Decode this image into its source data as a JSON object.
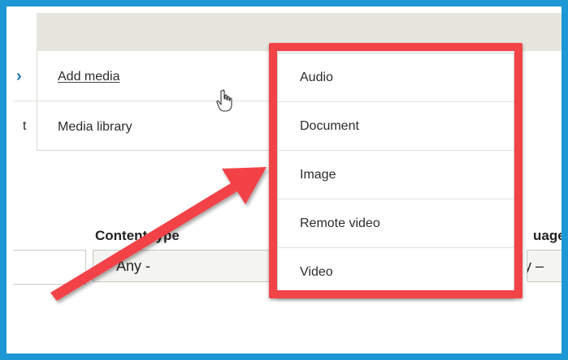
{
  "submenu": {
    "items": [
      {
        "label": "Add media",
        "icon": "chevron-right-icon"
      },
      {
        "label": "Media library"
      }
    ],
    "left_fragment": "t"
  },
  "dropdown": {
    "items": [
      {
        "label": "Audio"
      },
      {
        "label": "Document"
      },
      {
        "label": "Image"
      },
      {
        "label": "Remote video"
      },
      {
        "label": "Video"
      }
    ]
  },
  "filters": {
    "content_type": {
      "label": "Content type",
      "value": "- Any -"
    },
    "language": {
      "label": "uage",
      "value": "ny –"
    }
  },
  "colors": {
    "frame": "#1d97d6",
    "highlight": "#f24346",
    "top_bar": "#e6e5de"
  },
  "icons": {
    "cursor": "pointing-hand-icon",
    "chevron": "chevron-right-icon",
    "arrow": "red-arrow-icon"
  }
}
